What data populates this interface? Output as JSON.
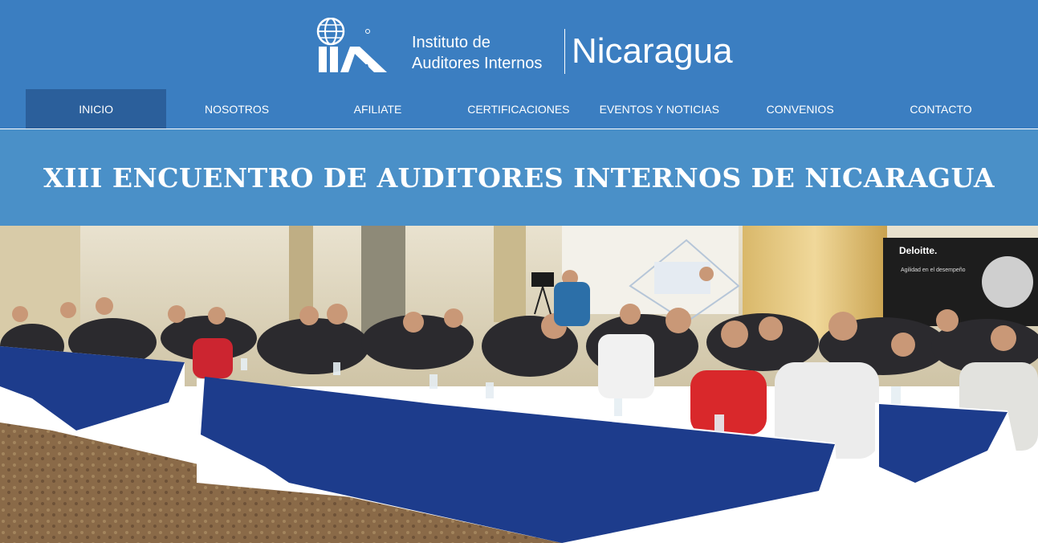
{
  "header": {
    "logo_text": "IIA",
    "org_line1": "Instituto de",
    "org_line2": "Auditores Internos",
    "country": "Nicaragua",
    "colors": {
      "header_bg": "#3b7ec1",
      "active_nav": "#2b5f9b",
      "banner_bg": "#4a90c8"
    }
  },
  "nav": {
    "items": [
      {
        "label": "INICIO",
        "active": true
      },
      {
        "label": "NOSOTROS"
      },
      {
        "label": "AFILIATE"
      },
      {
        "label": "CERTIFICACIONES"
      },
      {
        "label": "EVENTOS Y NOTICIAS"
      },
      {
        "label": "CONVENIOS"
      },
      {
        "label": "CONTACTO"
      }
    ]
  },
  "banner": {
    "title": "XIII ENCUENTRO DE AUDITORES INTERNOS DE NICARAGUA"
  },
  "photo": {
    "sponsor_sign": "Deloitte.",
    "sponsor_text": "Agilidad en el desempeño"
  }
}
